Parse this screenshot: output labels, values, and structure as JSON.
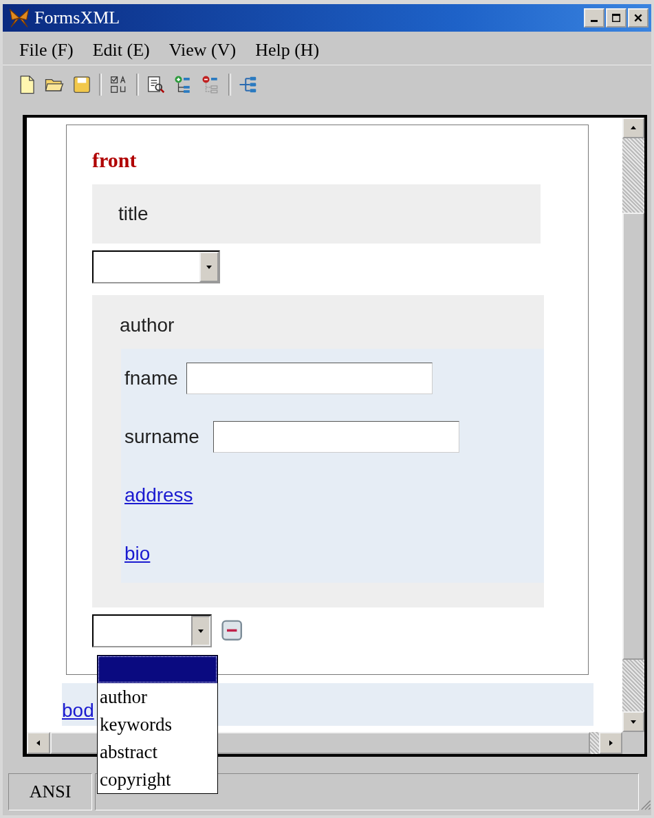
{
  "window": {
    "title": "FormsXML"
  },
  "menu": [
    "File (F)",
    "Edit (E)",
    "View (V)",
    "Help (H)"
  ],
  "form": {
    "heading": "front",
    "title_block": {
      "label": "title"
    },
    "author": {
      "label": "author",
      "fields": [
        {
          "kind": "input",
          "label": "fname"
        },
        {
          "kind": "input",
          "label": "surname"
        },
        {
          "kind": "link",
          "label": "address"
        },
        {
          "kind": "link",
          "label": "bio"
        }
      ]
    },
    "add_select": {
      "expanded": true,
      "options": [
        {
          "selected": true
        },
        {
          "label": "author",
          "selected": false
        },
        {
          "label": "keywords",
          "selected": false
        },
        {
          "label": "abstract",
          "selected": false
        },
        {
          "label": "copyright",
          "selected": false
        }
      ]
    }
  },
  "body_link": "bod",
  "status_bar": [
    "ANSI"
  ]
}
